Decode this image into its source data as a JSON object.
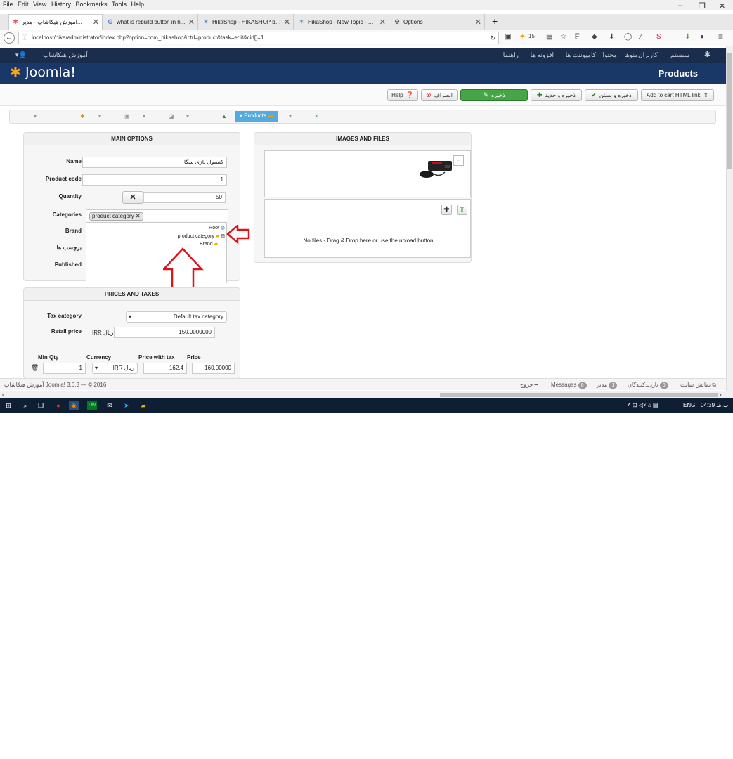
{
  "menubar": {
    "items": [
      "File",
      "Edit",
      "View",
      "History",
      "Bookmarks",
      "Tools",
      "Help"
    ]
  },
  "tabs": [
    {
      "label": "آموزش هیکاشاپ - مدیر...",
      "icon": "joomla-icon"
    },
    {
      "label": "what is rebuild button in h...",
      "icon": "google-icon"
    },
    {
      "label": "HikaShop - HIKASHOP bu...",
      "icon": "hikashop-icon"
    },
    {
      "label": "HikaShop - New Topic - H...",
      "icon": "hikashop-icon"
    },
    {
      "label": "Options",
      "icon": "gear-icon"
    }
  ],
  "newtab_label": "+",
  "address": {
    "url": "localhost/hika/administrator/index.php?option=com_hikashop&ctrl=product&task=edit&cid[]=1"
  },
  "weather_badge": "15",
  "joomla_nav": {
    "site_name": "آموزش هیکاشاپ",
    "items": [
      "سیستم",
      "کاربران",
      "منوها",
      "محتوا",
      "کامپوننت ها",
      "افزونه ها",
      "راهنما"
    ]
  },
  "header": {
    "logo_text": "Joomla!",
    "title": "Products"
  },
  "toolbar": {
    "add_to_cart": "Add to cart HTML link",
    "save_close": "ذخیره و بستن",
    "save_new": "ذخیره و جدید",
    "save": "ذخیره",
    "cancel": "انصراف",
    "help": "Help"
  },
  "submenu": {
    "active": "Products"
  },
  "main_options": {
    "heading": "MAIN OPTIONS",
    "name_label": "Name",
    "name_value": "کنسول بازی سگا",
    "code_label": "Product code",
    "code_value": "1",
    "quantity_label": "Quantity",
    "quantity_value": "50",
    "categories_label": "Categories",
    "category_tag": "product category",
    "brand_label": "Brand",
    "tags_label": "برچسب ها",
    "published_label": "Published",
    "tree": {
      "root": "Root",
      "category": "product category",
      "brand": "Brand"
    }
  },
  "images": {
    "heading": "IMAGES AND FILES",
    "no_files": "No files - Drag & Drop here or use the upload button"
  },
  "prices": {
    "heading": "PRICES AND TAXES",
    "tax_label": "Tax category",
    "tax_value": "Default tax category",
    "retail_label": "Retail price",
    "retail_currency": "IRR ریال",
    "retail_value": "150.0000000",
    "cols": {
      "min_qty": "Min Qty",
      "currency": "Currency",
      "price_tax": "Price with tax",
      "price": "Price"
    },
    "row": {
      "min_qty": "1",
      "currency": "IRR ریال",
      "price_tax": "162.4",
      "price": "160.00000"
    }
  },
  "footer": {
    "copyright": "آموزش هیکاشاپ Joomla! 3.6.3 — © 2016",
    "view_site": "نمایش سایت",
    "visitors_count": "0",
    "visitors": "بازدیدکنندگان",
    "admin_count": "1",
    "admin": "مدیر",
    "messages_count": "0",
    "messages": "Messages",
    "logout": "خروج"
  },
  "taskbar": {
    "lang": "ENG",
    "time": "04:39 ب.ظ"
  },
  "colors": {
    "joomla_nav": "#1b2d4c",
    "joomla_header": "#1a3867",
    "save_green": "#46a546",
    "arrow_red": "#d9151a"
  }
}
